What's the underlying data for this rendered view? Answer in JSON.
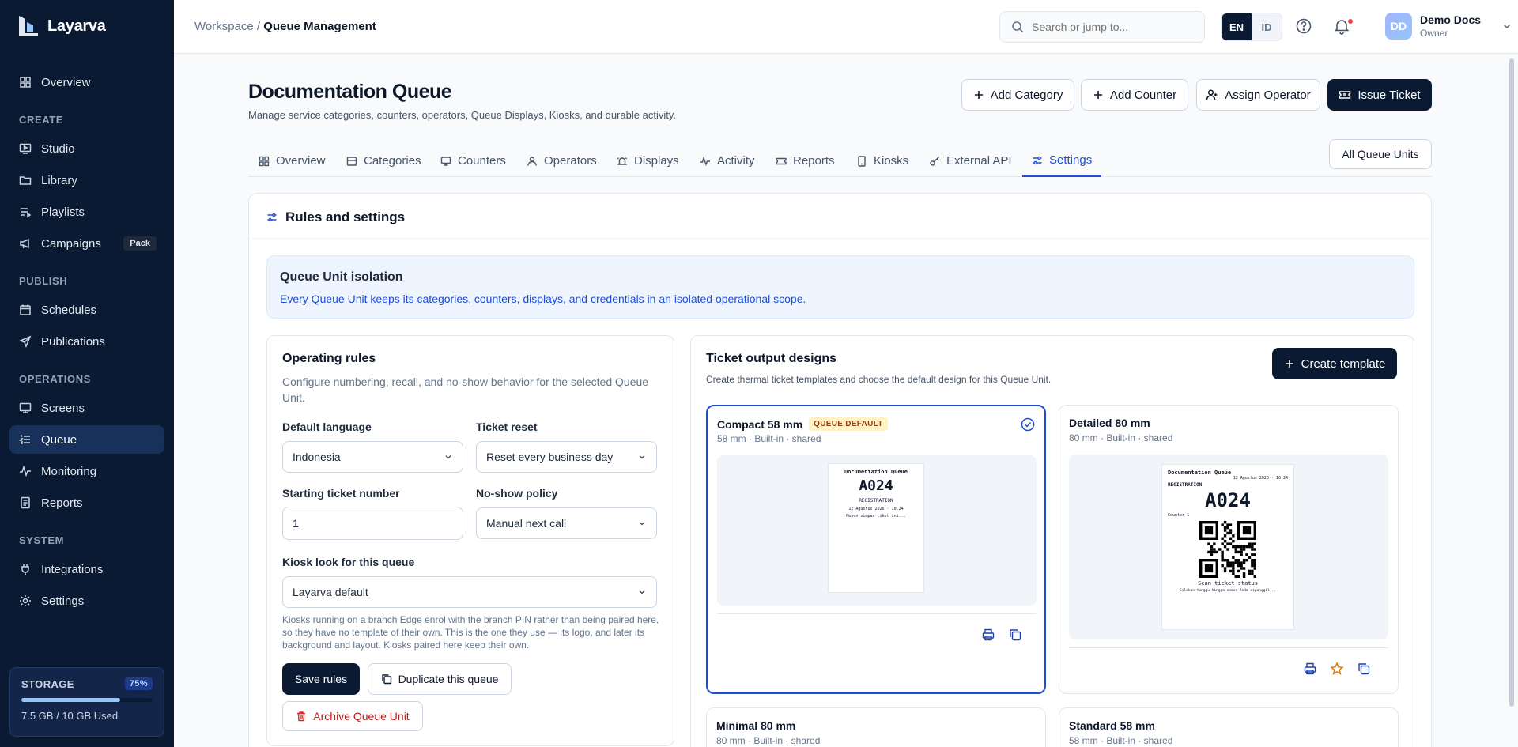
{
  "app": {
    "name": "Layarva"
  },
  "sidebar": {
    "top_item": {
      "label": "Overview"
    },
    "sections": [
      {
        "title": "CREATE",
        "items": [
          {
            "label": "Studio"
          },
          {
            "label": "Library"
          },
          {
            "label": "Playlists"
          },
          {
            "label": "Campaigns",
            "badge": "Pack"
          }
        ]
      },
      {
        "title": "PUBLISH",
        "items": [
          {
            "label": "Schedules"
          },
          {
            "label": "Publications"
          }
        ]
      },
      {
        "title": "OPERATIONS",
        "items": [
          {
            "label": "Screens"
          },
          {
            "label": "Queue",
            "active": true
          },
          {
            "label": "Monitoring"
          },
          {
            "label": "Reports"
          }
        ]
      },
      {
        "title": "SYSTEM",
        "items": [
          {
            "label": "Integrations"
          },
          {
            "label": "Settings"
          }
        ]
      }
    ],
    "storage": {
      "title": "STORAGE",
      "percent_label": "75%",
      "percent": 0.75,
      "used": "7.5 GB",
      "total": "/ 10 GB Used"
    }
  },
  "topbar": {
    "breadcrumb_root": "Workspace /",
    "breadcrumb_current": "Queue Management",
    "search_placeholder": "Search or jump to...",
    "lang_en": "EN",
    "lang_id": "ID",
    "user": {
      "initials": "DD",
      "name": "Demo Docs",
      "role": "Owner"
    }
  },
  "page": {
    "title": "Documentation Queue",
    "subtitle": "Manage service categories, counters, operators, Queue Displays, Kiosks, and durable activity.",
    "actions": {
      "add_category": "Add Category",
      "add_counter": "Add Counter",
      "assign_operator": "Assign Operator",
      "issue_ticket": "Issue Ticket",
      "all_units": "All Queue Units"
    },
    "tabs": [
      "Overview",
      "Categories",
      "Counters",
      "Operators",
      "Displays",
      "Activity",
      "Reports",
      "Kiosks",
      "External API",
      "Settings"
    ],
    "active_tab": "Settings"
  },
  "settings": {
    "title": "Rules and settings",
    "isolation": {
      "title": "Queue Unit isolation",
      "text": "Every Queue Unit keeps its categories, counters, displays, and credentials in an isolated operational scope."
    },
    "rules": {
      "title": "Operating rules",
      "description": "Configure numbering, recall, and no-show behavior for the selected Queue Unit.",
      "default_language": {
        "label": "Default language",
        "value": "Indonesia"
      },
      "ticket_reset": {
        "label": "Ticket reset",
        "value": "Reset every business day"
      },
      "starting_number": {
        "label": "Starting ticket number",
        "value": "1"
      },
      "no_show": {
        "label": "No-show policy",
        "value": "Manual next call"
      },
      "kiosk_look": {
        "label": "Kiosk look for this queue",
        "value": "Layarva default"
      },
      "note": "Kiosks running on a branch Edge enrol with the branch PIN rather than being paired here, so they have no template of their own. This is the one they use — its logo, and later its background and layout. Kiosks paired here keep their own.",
      "save": "Save rules",
      "duplicate": "Duplicate this queue",
      "archive": "Archive Queue Unit"
    },
    "tickets": {
      "title": "Ticket output designs",
      "description": "Create thermal ticket templates and choose the default design for this Queue Unit.",
      "create": "Create template",
      "cards": [
        {
          "name": "Compact 58 mm",
          "badge": "QUEUE DEFAULT",
          "meta": "58 mm · Built-in · shared",
          "preview": {
            "title": "Documentation Queue",
            "number": "A024",
            "category": "REGISTRATION",
            "date": "12 Agustus 2026 · 10.24",
            "footer": "Mohon simpan tiket ini..."
          }
        },
        {
          "name": "Detailed 80 mm",
          "meta": "80 mm · Built-in · shared",
          "preview": {
            "title": "Documentation Queue",
            "date": "12 Agustus 2026 · 10.24",
            "category": "REGISTRATION",
            "number": "A024",
            "counter": "Counter 1",
            "scan": "Scan ticket status",
            "footer": "Silakan tunggu hingga nomor Anda dipanggil..."
          }
        },
        {
          "name": "Minimal 80 mm",
          "meta": "80 mm · Built-in · shared"
        },
        {
          "name": "Standard 58 mm",
          "meta": "58 mm · Built-in · shared"
        }
      ]
    }
  },
  "colors": {
    "sidebar_bg": "#0b1a33",
    "accent": "#1d4ed8",
    "danger": "#dc2626",
    "badge_bg": "#fef3c7"
  }
}
